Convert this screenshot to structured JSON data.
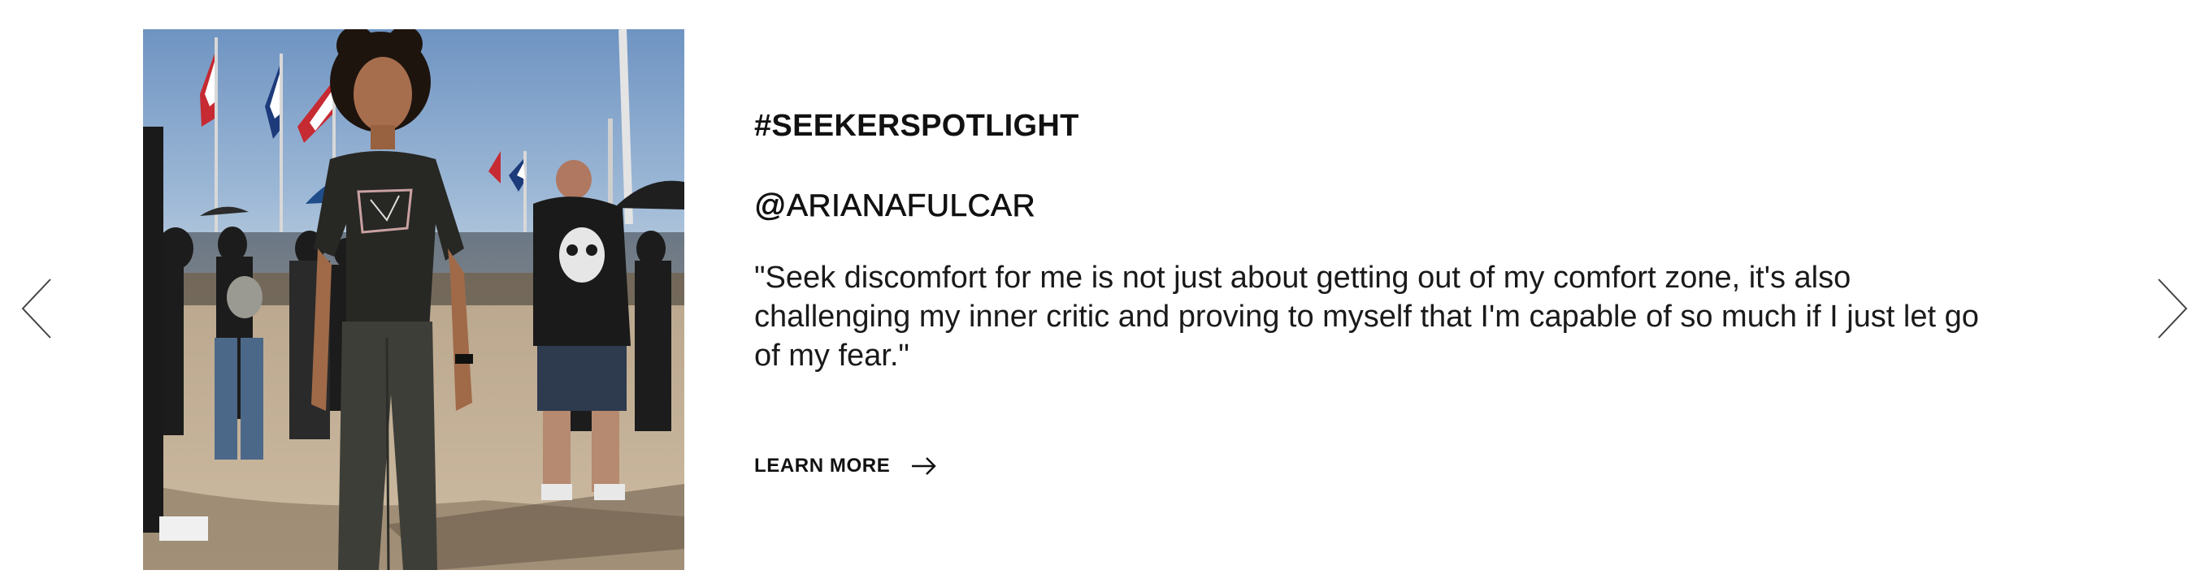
{
  "carousel": {
    "prev_icon": "chevron-left-icon",
    "next_icon": "chevron-right-icon"
  },
  "spotlight": {
    "photo_alt": "Woman in black t-shirt standing in a crowd with flags",
    "hashtag": "#SEEKERSPOTLIGHT",
    "handle": "@ARIANAFULCAR",
    "quote": "\"Seek discomfort for me is not just about getting out of my comfort zone, it's also challenging my inner critic and proving to myself that I'm capable of so much if I just let go of my fear.\"",
    "cta_label": "LEARN MORE",
    "cta_icon": "arrow-right-icon"
  },
  "colors": {
    "text": "#111111",
    "background": "#ffffff",
    "arrow_stroke": "#444444"
  }
}
